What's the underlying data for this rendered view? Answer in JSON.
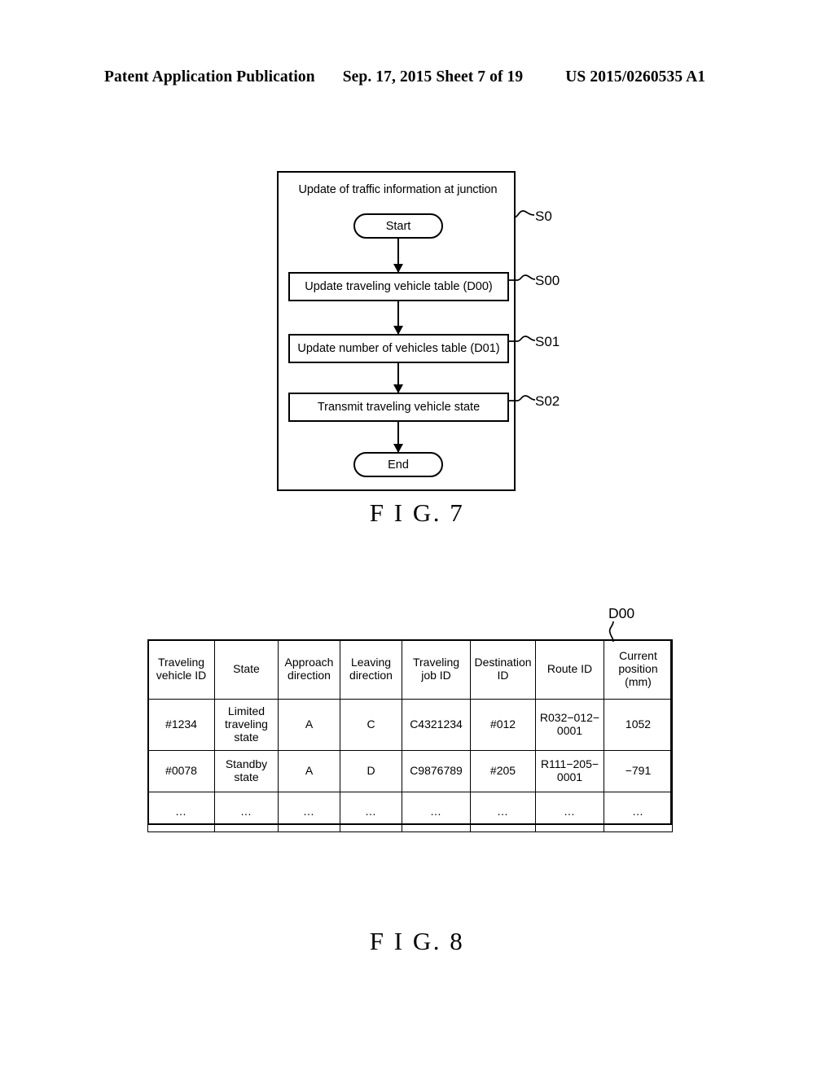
{
  "header": {
    "publication": "Patent Application Publication",
    "date_sheet": "Sep. 17, 2015  Sheet 7 of 19",
    "patent_number": "US 2015/0260535 A1"
  },
  "figures": {
    "fig7": {
      "caption": "F I G. 7",
      "title": "Update of traffic information at junction",
      "nodes": {
        "start": "Start",
        "step_s00": "Update traveling vehicle table (D00)",
        "step_s01": "Update number of vehicles table (D01)",
        "step_s02": "Transmit traveling vehicle state",
        "end": "End"
      },
      "step_labels": {
        "s0": "S0",
        "s00": "S00",
        "s01": "S01",
        "s02": "S02"
      }
    },
    "fig8": {
      "caption": "F I G. 8",
      "table_label": "D00",
      "table": {
        "columns": [
          "Traveling vehicle ID",
          "State",
          "Approach direction",
          "Leaving direction",
          "Traveling job ID",
          "Destination ID",
          "Route ID",
          "Current position (mm)"
        ],
        "column_lines": [
          [
            "Traveling",
            "vehicle ID"
          ],
          [
            "State"
          ],
          [
            "Approach",
            "direction"
          ],
          [
            "Leaving",
            "direction"
          ],
          [
            "Traveling",
            "job ID"
          ],
          [
            "Destination",
            "ID"
          ],
          [
            "Route ID"
          ],
          [
            "Current",
            "position",
            "(mm)"
          ]
        ],
        "rows": [
          {
            "traveling_vehicle_id": "#1234",
            "state_line1": "Limited",
            "state_line2": "traveling",
            "state_line3": "state",
            "approach_direction": "A",
            "leaving_direction": "C",
            "traveling_job_id": "C4321234",
            "destination_id": "#012",
            "route_id_line1": "R032−012−",
            "route_id_line2": "0001",
            "current_position": "1052"
          },
          {
            "traveling_vehicle_id": "#0078",
            "state_line1": "Standby",
            "state_line2": "state",
            "state_line3": "",
            "approach_direction": "A",
            "leaving_direction": "D",
            "traveling_job_id": "C9876789",
            "destination_id": "#205",
            "route_id_line1": "R111−205−",
            "route_id_line2": "0001",
            "current_position": "−791"
          }
        ],
        "ellipsis": "…"
      }
    }
  },
  "colors": {
    "ink": "#000000",
    "page": "#ffffff"
  }
}
